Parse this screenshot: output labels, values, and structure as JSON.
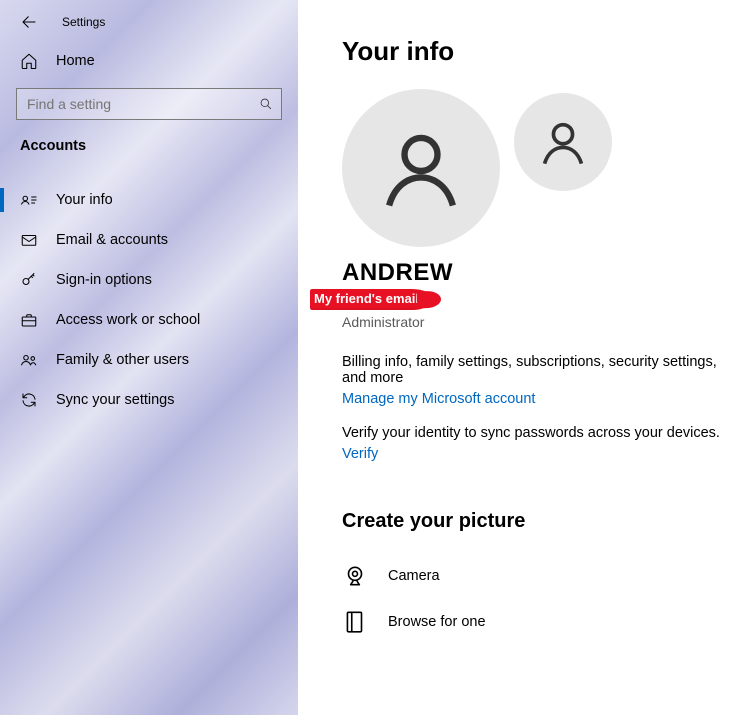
{
  "header": {
    "settings_label": "Settings"
  },
  "sidebar": {
    "home_label": "Home",
    "search_placeholder": "Find a setting",
    "section_label": "Accounts",
    "items": [
      {
        "label": "Your info"
      },
      {
        "label": "Email & accounts"
      },
      {
        "label": "Sign-in options"
      },
      {
        "label": "Access work or school"
      },
      {
        "label": "Family & other users"
      },
      {
        "label": "Sync your settings"
      }
    ]
  },
  "main": {
    "title": "Your info",
    "user_name": "ANDREW",
    "redacted_email_label": "My friend's email",
    "role": "Administrator",
    "billing_text": "Billing info, family settings, subscriptions, security settings, and more",
    "manage_link": "Manage my Microsoft account",
    "verify_text": "Verify your identity to sync passwords across your devices.",
    "verify_link": "Verify",
    "picture_heading": "Create your picture",
    "camera_label": "Camera",
    "browse_label": "Browse for one"
  }
}
